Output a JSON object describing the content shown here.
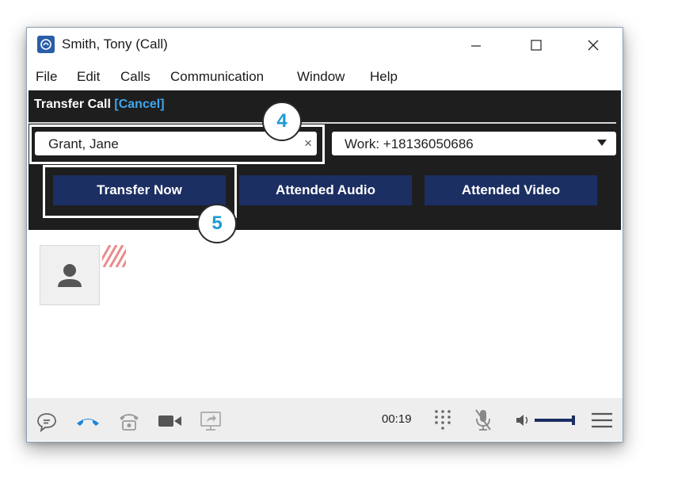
{
  "window": {
    "title": "Smith, Tony (Call)"
  },
  "menu": [
    "File",
    "Edit",
    "Calls",
    "Communication",
    "Window",
    "Help"
  ],
  "transfer": {
    "heading": "Transfer Call",
    "cancel_label": "[Cancel]",
    "recipient_name": "Grant, Jane",
    "clear_symbol": "×",
    "selected_number": "Work: +18136050686",
    "buttons": {
      "transfer_now": "Transfer Now",
      "attended_audio": "Attended Audio",
      "attended_video": "Attended Video"
    }
  },
  "callouts": {
    "step_a": "4",
    "step_b": "5"
  },
  "toolbar": {
    "call_timer": "00:19"
  },
  "colors": {
    "panel_bg": "#1e1e1e",
    "button_bg": "#1c2f63",
    "cancel_link": "#3fa7f0",
    "callout_number": "#1f9ad6",
    "hangup_icon": "#1f86d6"
  },
  "icons": [
    "app-icon",
    "minimize-icon",
    "maximize-icon",
    "close-icon",
    "clear-icon",
    "chevron-down-icon",
    "avatar-icon",
    "chat-icon",
    "hang-up-icon",
    "phone-icon",
    "video-camera-icon",
    "share-screen-icon",
    "dialpad-icon",
    "microphone-muted-icon",
    "speaker-volume-icon",
    "menu-icon"
  ]
}
